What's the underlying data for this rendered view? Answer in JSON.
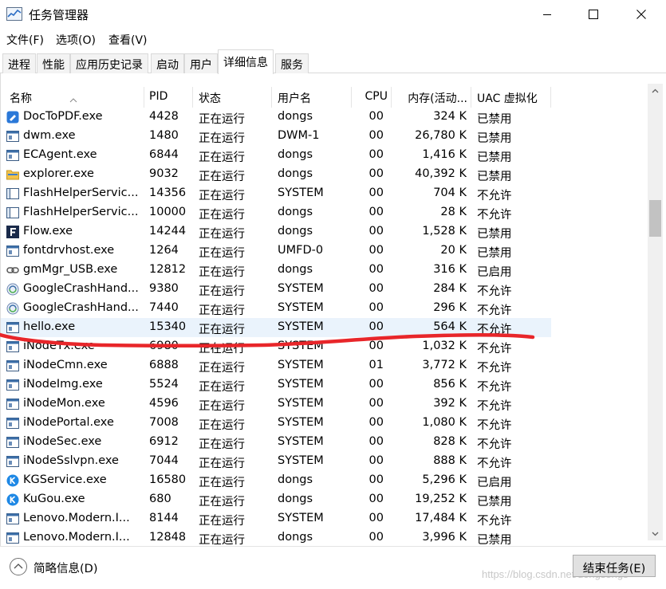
{
  "window": {
    "title": "任务管理器"
  },
  "menu": [
    "文件(F)",
    "选项(O)",
    "查看(V)"
  ],
  "tabs": [
    {
      "label": "进程",
      "active": false
    },
    {
      "label": "性能",
      "active": false
    },
    {
      "label": "应用历史记录",
      "active": false
    },
    {
      "label": "启动",
      "active": false
    },
    {
      "label": "用户",
      "active": false
    },
    {
      "label": "详细信息",
      "active": true
    },
    {
      "label": "服务",
      "active": false
    }
  ],
  "columns": [
    "名称",
    "PID",
    "状态",
    "用户名",
    "CPU",
    "内存(活动...",
    "UAC 虚拟化"
  ],
  "rows": [
    {
      "name": "DocToPDF.exe",
      "pid": "4428",
      "status": "正在运行",
      "user": "dongs",
      "cpu": "00",
      "mem": "324 K",
      "uac": "已禁用",
      "icon": "blue-doc-icon"
    },
    {
      "name": "dwm.exe",
      "pid": "1480",
      "status": "正在运行",
      "user": "DWM-1",
      "cpu": "00",
      "mem": "26,780 K",
      "uac": "已禁用",
      "icon": "app-window-icon"
    },
    {
      "name": "ECAgent.exe",
      "pid": "6844",
      "status": "正在运行",
      "user": "dongs",
      "cpu": "00",
      "mem": "1,416 K",
      "uac": "已禁用",
      "icon": "app-window-icon"
    },
    {
      "name": "explorer.exe",
      "pid": "9032",
      "status": "正在运行",
      "user": "dongs",
      "cpu": "00",
      "mem": "40,392 K",
      "uac": "已禁用",
      "icon": "folder-icon"
    },
    {
      "name": "FlashHelperServic...",
      "pid": "14356",
      "status": "正在运行",
      "user": "SYSTEM",
      "cpu": "00",
      "mem": "704 K",
      "uac": "不允许",
      "icon": "service-window-icon"
    },
    {
      "name": "FlashHelperServic...",
      "pid": "10000",
      "status": "正在运行",
      "user": "dongs",
      "cpu": "00",
      "mem": "28 K",
      "uac": "不允许",
      "icon": "service-window-icon"
    },
    {
      "name": "Flow.exe",
      "pid": "14244",
      "status": "正在运行",
      "user": "dongs",
      "cpu": "00",
      "mem": "1,528 K",
      "uac": "已禁用",
      "icon": "flow-f-icon"
    },
    {
      "name": "fontdrvhost.exe",
      "pid": "1264",
      "status": "正在运行",
      "user": "UMFD-0",
      "cpu": "00",
      "mem": "20 K",
      "uac": "已禁用",
      "icon": "app-window-icon"
    },
    {
      "name": "gmMgr_USB.exe",
      "pid": "12812",
      "status": "正在运行",
      "user": "dongs",
      "cpu": "00",
      "mem": "316 K",
      "uac": "已启用",
      "icon": "link-icon"
    },
    {
      "name": "GoogleCrashHand...",
      "pid": "9380",
      "status": "正在运行",
      "user": "SYSTEM",
      "cpu": "00",
      "mem": "284 K",
      "uac": "不允许",
      "icon": "google-update-icon"
    },
    {
      "name": "GoogleCrashHand...",
      "pid": "7440",
      "status": "正在运行",
      "user": "SYSTEM",
      "cpu": "00",
      "mem": "296 K",
      "uac": "不允许",
      "icon": "google-update-icon"
    },
    {
      "name": "hello.exe",
      "pid": "15340",
      "status": "正在运行",
      "user": "SYSTEM",
      "cpu": "00",
      "mem": "564 K",
      "uac": "不允许",
      "icon": "app-window-icon",
      "selected": true
    },
    {
      "name": "iNodeTx.exe",
      "pid": "6980",
      "status": "正在运行",
      "user": "SYSTEM",
      "cpu": "00",
      "mem": "1,032 K",
      "uac": "不允许",
      "icon": "app-window-icon"
    },
    {
      "name": "iNodeCmn.exe",
      "pid": "6888",
      "status": "正在运行",
      "user": "SYSTEM",
      "cpu": "01",
      "mem": "3,772 K",
      "uac": "不允许",
      "icon": "app-window-icon"
    },
    {
      "name": "iNodeImg.exe",
      "pid": "5524",
      "status": "正在运行",
      "user": "SYSTEM",
      "cpu": "00",
      "mem": "856 K",
      "uac": "不允许",
      "icon": "app-window-icon"
    },
    {
      "name": "iNodeMon.exe",
      "pid": "4596",
      "status": "正在运行",
      "user": "SYSTEM",
      "cpu": "00",
      "mem": "392 K",
      "uac": "不允许",
      "icon": "app-window-icon"
    },
    {
      "name": "iNodePortal.exe",
      "pid": "7008",
      "status": "正在运行",
      "user": "SYSTEM",
      "cpu": "00",
      "mem": "1,080 K",
      "uac": "不允许",
      "icon": "app-window-icon"
    },
    {
      "name": "iNodeSec.exe",
      "pid": "6912",
      "status": "正在运行",
      "user": "SYSTEM",
      "cpu": "00",
      "mem": "828 K",
      "uac": "不允许",
      "icon": "app-window-icon"
    },
    {
      "name": "iNodeSslvpn.exe",
      "pid": "7044",
      "status": "正在运行",
      "user": "SYSTEM",
      "cpu": "00",
      "mem": "888 K",
      "uac": "不允许",
      "icon": "app-window-icon"
    },
    {
      "name": "KGService.exe",
      "pid": "16580",
      "status": "正在运行",
      "user": "dongs",
      "cpu": "00",
      "mem": "5,296 K",
      "uac": "已启用",
      "icon": "kugou-k-icon"
    },
    {
      "name": "KuGou.exe",
      "pid": "680",
      "status": "正在运行",
      "user": "dongs",
      "cpu": "00",
      "mem": "19,252 K",
      "uac": "已禁用",
      "icon": "kugou-k-icon"
    },
    {
      "name": "Lenovo.Modern.I...",
      "pid": "8144",
      "status": "正在运行",
      "user": "SYSTEM",
      "cpu": "00",
      "mem": "17,484 K",
      "uac": "不允许",
      "icon": "app-window-icon"
    },
    {
      "name": "Lenovo.Modern.I...",
      "pid": "12848",
      "status": "正在运行",
      "user": "dongs",
      "cpu": "00",
      "mem": "3,996 K",
      "uac": "已禁用",
      "icon": "app-window-icon"
    }
  ],
  "footer": {
    "brief_label": "简略信息(D)",
    "end_task_label": "结束任务(E)",
    "watermark": "https://blog.csdn.net/dongsongs"
  },
  "colors": {
    "selected_row": "#eaf3fc",
    "annotation_stroke": "#e8262a"
  }
}
